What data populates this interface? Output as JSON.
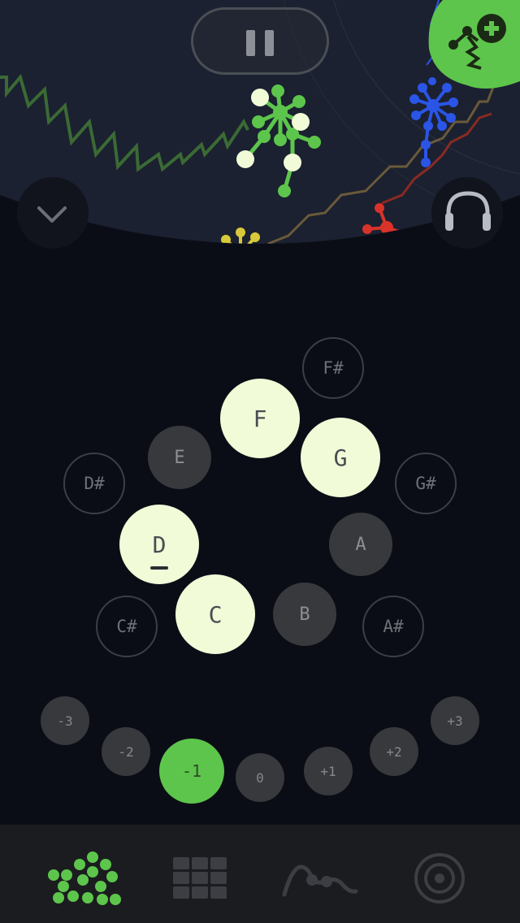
{
  "notes": {
    "c": "C",
    "c_sharp": "C#",
    "d": "D",
    "d_sharp": "D#",
    "e": "E",
    "f": "F",
    "f_sharp": "F#",
    "g": "G",
    "g_sharp": "G#",
    "a": "A",
    "a_sharp": "A#",
    "b": "B"
  },
  "octave_shift": {
    "minus_3": "-3",
    "minus_2": "-2",
    "minus_1": "-1",
    "zero": "0",
    "plus_1": "+1",
    "plus_2": "+2",
    "plus_3": "+3",
    "selected": "-1"
  },
  "icons": {
    "pause": "pause-icon",
    "add_creature": "add-creature-icon",
    "collapse": "chevron-down-icon",
    "headphones": "headphones-icon",
    "tab_creatures": "creatures-dots-icon",
    "tab_grid": "grid-icon",
    "tab_curve": "curve-icon",
    "tab_target": "target-icon"
  },
  "colors": {
    "background": "#0b0d16",
    "lit_note": "#f1fbd8",
    "dark_note": "#38393c",
    "accent_green": "#5dc54c",
    "blue_creature": "#2a55e6",
    "red_creature": "#d8332a",
    "yellow_creature": "#d9c93a"
  }
}
